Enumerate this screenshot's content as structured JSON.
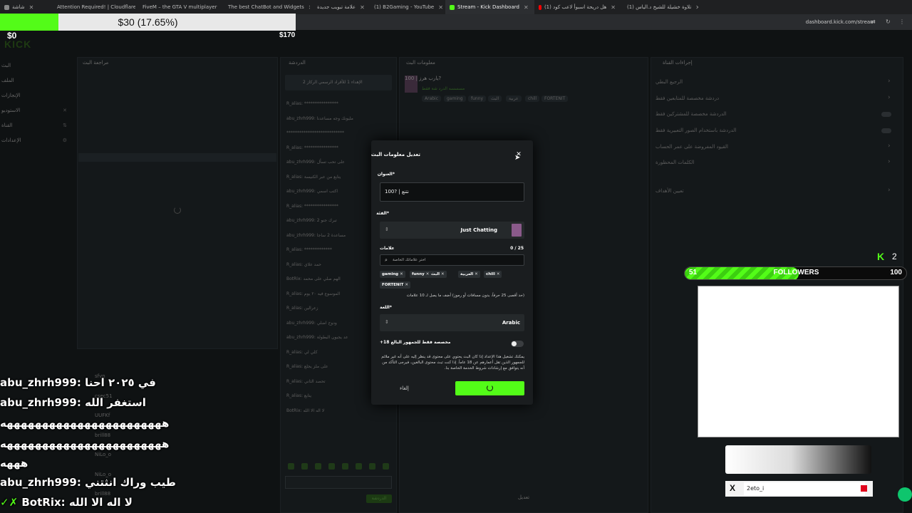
{
  "browser": {
    "tabs": [
      {
        "label": "شاشة",
        "color": "#888888",
        "active": false
      },
      {
        "label": "Attention Required! | Cloudflare",
        "color": "#f38020",
        "active": false
      },
      {
        "label": "FiveM – the GTA V multiplayer",
        "color": "#f40552",
        "active": false
      },
      {
        "label": "The best ChatBot and Widgets",
        "color": "#dddddd",
        "active": false
      },
      {
        "label": "علامة تبويب جديدة",
        "color": "#888888",
        "active": false
      },
      {
        "label": "(1) B2Gaming - YouTube",
        "color": "#ff0000",
        "active": false
      },
      {
        "label": "Stream - Kick Dashboard",
        "color": "#53fc18",
        "active": true
      },
      {
        "label": "(1) هل دريحة اسبوأ لاعب كود",
        "color": "#ff0000",
        "active": false
      },
      {
        "label": "(1) تلاوة خشيلة للشيخ د.الياس",
        "color": "#ff0000",
        "active": false
      }
    ],
    "url": "dashboard.kick.com/stream"
  },
  "goal": {
    "min": "$0",
    "max": "$170",
    "current_text": "$30 (17.65%)",
    "progress": 0.1765,
    "colors": {
      "fill": "#53fc18",
      "track": "#e8e8e8"
    }
  },
  "dashboard": {
    "logo": "KICK",
    "sidebar": [
      {
        "label": "البث",
        "icon": ""
      },
      {
        "label": "الملف",
        "icon": ""
      },
      {
        "label": "الإنجازات",
        "icon": ""
      },
      {
        "label": "الاستوديو",
        "icon": "✕"
      },
      {
        "label": "القناة",
        "icon": "⇅"
      },
      {
        "label": "الإعدادات",
        "icon": "⚙"
      }
    ],
    "panels": {
      "preview": "مراجعة البث",
      "chat": "الدردشة",
      "info": "معلومات البث",
      "actions": "إجراءات القناة"
    },
    "pinned": "الإهداء 1 للأقراد الرسمي الركاز 2",
    "chat_lines": [
      "R_alias: ****************",
      "abu_zhrh999: مليونك وجه مساعدنا",
      "***************************",
      "R_alias: ****************",
      "abu_zhrh999: على تحب تسأل",
      "R_alias: يتابع من عبر الكنيسة",
      "abu_zhrh999: اكتب اسمي",
      "R_alias: ****************",
      "abu_zhrh999: 2 تبرك جنو",
      "abu_zhrh999: مساعدة 2 ساجا",
      "R_alias: *************",
      "R_alias: حمد علاي",
      "BotRix: الهم صلي على محمد",
      "R_alias: الموسوع فيه ٢٠ يوم",
      "R_alias: زعرالين",
      "abu_zhrh999: ودوح اضلي",
      "abu_zhrh999: عد يجبون البطولة",
      "R_alias: كلي لي",
      "R_alias: على ملز يجلع",
      "R_alias: تحصد الثاني",
      "R_alias: يتابع",
      "BotRix: لا اله الا الله"
    ],
    "info_title": "يارب هرز | 100?",
    "info_category": "مسسسه الدرد شة فقط",
    "info_tags": [
      "Arabic",
      "gaming",
      "funny",
      "البث",
      "عربية",
      "chill",
      "FORTENIT"
    ],
    "actions": [
      {
        "label": "الرجيع البطي",
        "toggle": false
      },
      {
        "label": "دردشة مخصصة للمتابعين فقط",
        "toggle": false
      },
      {
        "label": "الدردشة مخصصة للمشتركين فقط",
        "toggle": true
      },
      {
        "label": "الدردشة باستخدام الصور التعبيرية فقط",
        "toggle": true
      },
      {
        "label": "القيود المفروضة على عمر الحساب",
        "toggle": false
      },
      {
        "label": "الكلمات المحظورة",
        "toggle": false
      },
      {
        "label": "تعيين الأهداف",
        "toggle": false
      }
    ],
    "footer_btn": "تعديل",
    "send_btn": "الدردشة"
  },
  "modal": {
    "title": "تعديل معلومات البث",
    "title_label": "العنوان*",
    "title_value": "100? | نتنع",
    "category_label": "الفئة*",
    "category_value": "Just Chatting",
    "tags_label": "علامات",
    "tags_count": "0 / 25",
    "tags_placeholder": "اختر علاماتك الخاصة",
    "tags": [
      "gaming",
      "funny",
      "البث",
      "العربية",
      "chill",
      "FORTENIT"
    ],
    "tags_help": "(حد أقصى 25 حرفاً، بدون مسافات أو رموز) أضف ما يصل لـ 10 علامات",
    "language_label": "اللغة*",
    "language_value": "Arabic",
    "mature_label": "مخصصة فقط للجمهور البالغ 18+",
    "mature_help": "يمكنك تشغيل هذا الإعداد إذا كان البث يحتوي على محتوى قد ينظر إليه على أنه غير ملائم للجمهور الذين تقل أعمارهم عن 18 عاماً. إذا كنت تبث محتوى البالغين، فيرجى التأكد من أنه يتوافق مع إرشادات شروط الخدمة الخاصة بنا.",
    "cancel_label": "إلغاء",
    "save_color": "#53fc18"
  },
  "chat_overlay": [
    {
      "user": "abu_zhrh999",
      "message": "في ٢٠٢٥ احنا"
    },
    {
      "user": "abu_zhrh999",
      "message": "استغفر الله"
    },
    {
      "user": "",
      "message": "هههههههههههههههههههههههه"
    },
    {
      "user": "",
      "message": "هههههههههههههههههههههههه"
    },
    {
      "user": "",
      "message": "هههه"
    },
    {
      "user": "abu_zhrh999",
      "message": "طيب وراك انثتني"
    },
    {
      "user": "BotRix",
      "message": "لا اله الا الله"
    }
  ],
  "overlay_chat_bg": [
    {
      "user": "sfvn",
      "msg": ""
    },
    {
      "user": "csec51",
      "msg": ""
    },
    {
      "user": "UUFKf",
      "msg": ""
    },
    {
      "user": "brill88",
      "msg": ""
    },
    {
      "user": "NiLo_o",
      "msg": ""
    },
    {
      "user": "NiLo_o",
      "msg": ""
    },
    {
      "user": "brill88",
      "msg": ""
    }
  ],
  "followers": {
    "label": "FOLLOWERS",
    "current": "51",
    "goal": "100",
    "progress": 0.51,
    "kick_viewers": "2"
  },
  "x_name": "2eto_i"
}
